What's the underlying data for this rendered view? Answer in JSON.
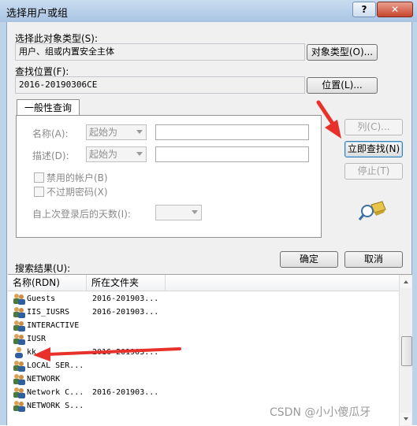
{
  "window": {
    "title": "选择用户或组",
    "help": "?",
    "close": "✕"
  },
  "object_type": {
    "label": "选择此对象类型(S):",
    "value": "用户、组或内置安全主体",
    "button": "对象类型(O)..."
  },
  "location": {
    "label": "查找位置(F):",
    "value": "2016-20190306CE",
    "button": "位置(L)..."
  },
  "tab": {
    "label": "一般性查询"
  },
  "query": {
    "name_label": "名称(A):",
    "name_combo": "起始为",
    "desc_label": "描述(D):",
    "desc_combo": "起始为",
    "disabled_accounts": "禁用的帐户(B)",
    "non_expiring_pw": "不过期密码(X)",
    "days_label": "自上次登录后的天数(I):"
  },
  "side_buttons": {
    "columns": "列(C)...",
    "find_now": "立即查找(N)",
    "stop": "停止(T)"
  },
  "ok": "确定",
  "cancel": "取消",
  "results": {
    "label": "搜索结果(U):",
    "col_name": "名称(RDN)",
    "col_folder": "所在文件夹",
    "rows": [
      {
        "name": "Guests",
        "folder": "2016-201903...",
        "icon": "group-icon"
      },
      {
        "name": "IIS_IUSRS",
        "folder": "2016-201903...",
        "icon": "group-icon"
      },
      {
        "name": "INTERACTIVE",
        "folder": "",
        "icon": "group-icon"
      },
      {
        "name": "IUSR",
        "folder": "",
        "icon": "group-icon"
      },
      {
        "name": "kk",
        "folder": "2016-201903...",
        "icon": "user-icon"
      },
      {
        "name": "LOCAL SER...",
        "folder": "",
        "icon": "group-icon"
      },
      {
        "name": "NETWORK",
        "folder": "",
        "icon": "group-icon"
      },
      {
        "name": "Network C...",
        "folder": "2016-201903...",
        "icon": "group-icon"
      },
      {
        "name": "NETWORK S...",
        "folder": "",
        "icon": "group-icon"
      }
    ]
  },
  "watermark": "CSDN @小小傻瓜牙",
  "colors": {
    "annotation_arrow": "#e8312a",
    "title_bar": "#bcd3ea"
  }
}
